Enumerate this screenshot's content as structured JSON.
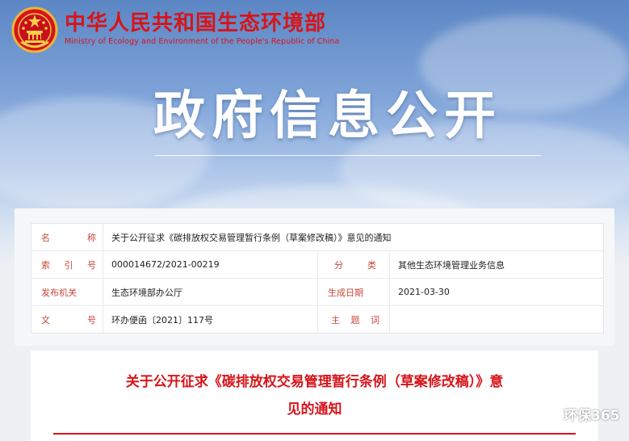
{
  "header": {
    "ministry_cn": "中华人民共和国生态环境部",
    "ministry_en": "Ministry of Ecology and Environment of the People's Republic of China",
    "hero_title": "政府信息公开",
    "brand_color": "#d7141a"
  },
  "info": {
    "name_label": [
      "名",
      "称"
    ],
    "name_value": "关于公开征求《碳排放权交易管理暂行条例（草案修改稿）》意见的通知",
    "index_label": [
      "索",
      "引",
      "号"
    ],
    "index_value": "000014672/2021-00219",
    "category_label": [
      "分",
      "类"
    ],
    "category_value": "其他生态环境管理业务信息",
    "issuer_label": "发布机关",
    "issuer_value": "生态环境部办公厅",
    "date_label": "生成日期",
    "date_value": "2021-03-30",
    "docno_label": [
      "文",
      "号"
    ],
    "docno_value": "环办便函〔2021〕117号",
    "subject_label": [
      "主",
      "题",
      "词"
    ],
    "subject_value": ""
  },
  "document": {
    "title_line1": "关于公开征求《碳排放权交易管理暂行条例（草案修改稿）》意",
    "title_line2": "见的通知"
  },
  "watermark": {
    "text": "环保365",
    "icon": "wechat-icon"
  }
}
